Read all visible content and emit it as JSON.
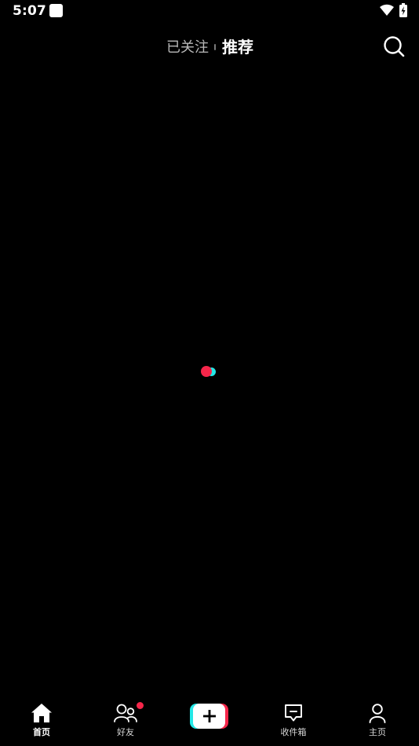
{
  "status_bar": {
    "time": "5:07",
    "icons": [
      "app-notification-icon",
      "wifi-icon",
      "battery-charging-icon"
    ]
  },
  "top_nav": {
    "tabs": [
      {
        "label": "已关注",
        "active": false
      },
      {
        "label": "推荐",
        "active": true
      }
    ],
    "search_icon": "search-icon"
  },
  "content": {
    "loading_indicator": "loading-dots",
    "colors": {
      "red": "#f6264a",
      "cyan": "#23e8e7"
    }
  },
  "bottom_nav": {
    "items": [
      {
        "label": "首页",
        "icon": "home-icon",
        "active": true
      },
      {
        "label": "好友",
        "icon": "friends-icon",
        "active": false,
        "badge": true
      },
      {
        "label": "",
        "icon": "create-plus-icon",
        "active": false
      },
      {
        "label": "收件箱",
        "icon": "inbox-icon",
        "active": false
      },
      {
        "label": "主页",
        "icon": "profile-icon",
        "active": false
      }
    ]
  }
}
